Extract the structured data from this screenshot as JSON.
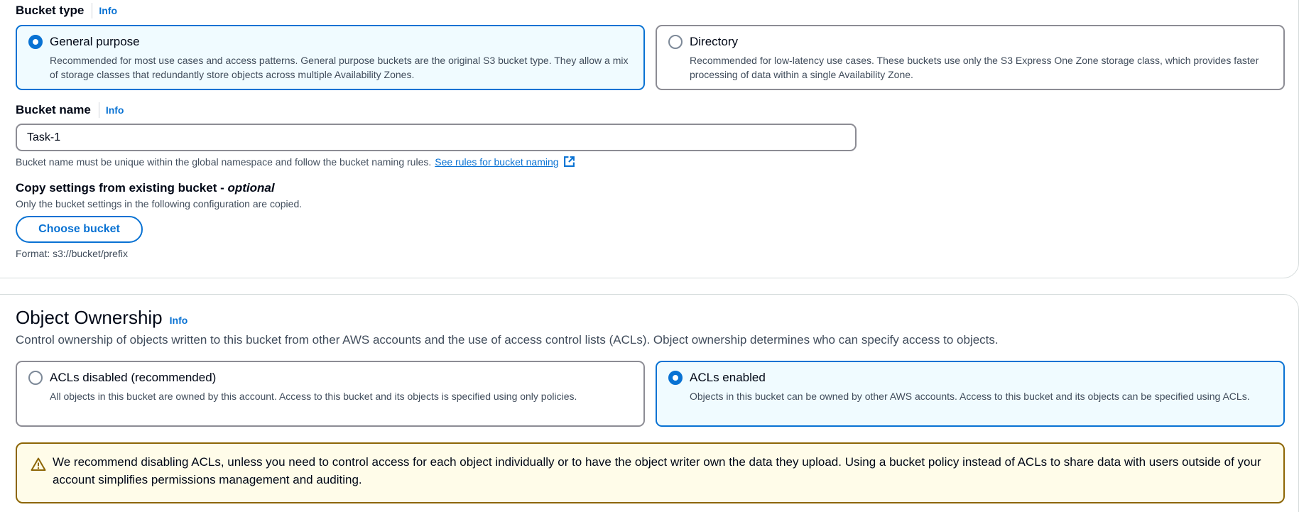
{
  "bucket_type": {
    "label": "Bucket type",
    "info": "Info",
    "options": [
      {
        "title": "General purpose",
        "description": "Recommended for most use cases and access patterns. General purpose buckets are the original S3 bucket type. They allow a mix of storage classes that redundantly store objects across multiple Availability Zones.",
        "selected": true
      },
      {
        "title": "Directory",
        "description": "Recommended for low-latency use cases. These buckets use only the S3 Express One Zone storage class, which provides faster processing of data within a single Availability Zone.",
        "selected": false
      }
    ]
  },
  "bucket_name": {
    "label": "Bucket name",
    "info": "Info",
    "value": "Task-1",
    "constraint": "Bucket name must be unique within the global namespace and follow the bucket naming rules.",
    "link": "See rules for bucket naming",
    "link_icon": "external-link-icon"
  },
  "copy_settings": {
    "title": "Copy settings from existing bucket - ",
    "title_optional": "optional",
    "description": "Only the bucket settings in the following configuration are copied.",
    "button": "Choose bucket",
    "format": "Format: s3://bucket/prefix"
  },
  "object_ownership": {
    "title": "Object Ownership",
    "info": "Info",
    "description": "Control ownership of objects written to this bucket from other AWS accounts and the use of access control lists (ACLs). Object ownership determines who can specify access to objects.",
    "options": [
      {
        "title": "ACLs disabled (recommended)",
        "description": "All objects in this bucket are owned by this account. Access to this bucket and its objects is specified using only policies.",
        "selected": false
      },
      {
        "title": "ACLs enabled",
        "description": "Objects in this bucket can be owned by other AWS accounts. Access to this bucket and its objects can be specified using ACLs.",
        "selected": true
      }
    ],
    "warning": "We recommend disabling ACLs, unless you need to control access for each object individually or to have the object writer own the data they upload. Using a bucket policy instead of ACLs to share data with users outside of your account simplifies permissions management and auditing.",
    "warning_icon": "warning-icon"
  },
  "colors": {
    "accent": "#0972d3",
    "selected_bg": "#f0fbff",
    "warning_border": "#8d6605",
    "warning_bg": "#fffce9"
  }
}
